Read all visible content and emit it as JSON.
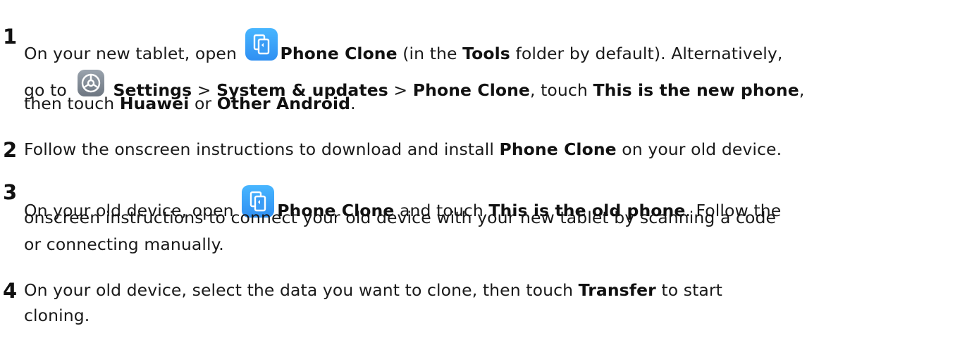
{
  "steps": [
    {
      "number": "1",
      "line1": {
        "t1": "On your new tablet, open ",
        "b1": "Phone Clone",
        "t2": " (in the ",
        "b2": "Tools",
        "t3": " folder by default). Alternatively,"
      },
      "line2": {
        "t1": "go to ",
        "b1": "Settings",
        "t2": " > ",
        "b2": "System & updates",
        "t3": " > ",
        "b3": "Phone Clone",
        "t4": ", touch ",
        "b4": "This is the new phone",
        "t5": ","
      },
      "line3": {
        "t1": "then touch ",
        "b1": "Huawei",
        "t2": " or ",
        "b2": "Other Android",
        "t3": "."
      }
    },
    {
      "number": "2",
      "line1": {
        "t1": "Follow the onscreen instructions to download and install ",
        "b1": "Phone Clone",
        "t2": " on your old device."
      }
    },
    {
      "number": "3",
      "line1": {
        "t1": "On your old device, open ",
        "b1": "Phone Clone",
        "t2": " and touch ",
        "b2": "This is the old phone",
        "t3": ". Follow the"
      },
      "line2": {
        "t1": "onscreen instructions to connect your old device with your new tablet by scanning a code"
      },
      "line3": {
        "t1": "or connecting manually."
      }
    },
    {
      "number": "4",
      "line1": {
        "t1": "On your old device, select the data you want to clone, then touch ",
        "b1": "Transfer",
        "t2": " to start"
      },
      "line2": {
        "t1": "cloning."
      }
    }
  ],
  "icons": {
    "phone_clone": "phone-clone-icon",
    "settings": "settings-icon"
  }
}
